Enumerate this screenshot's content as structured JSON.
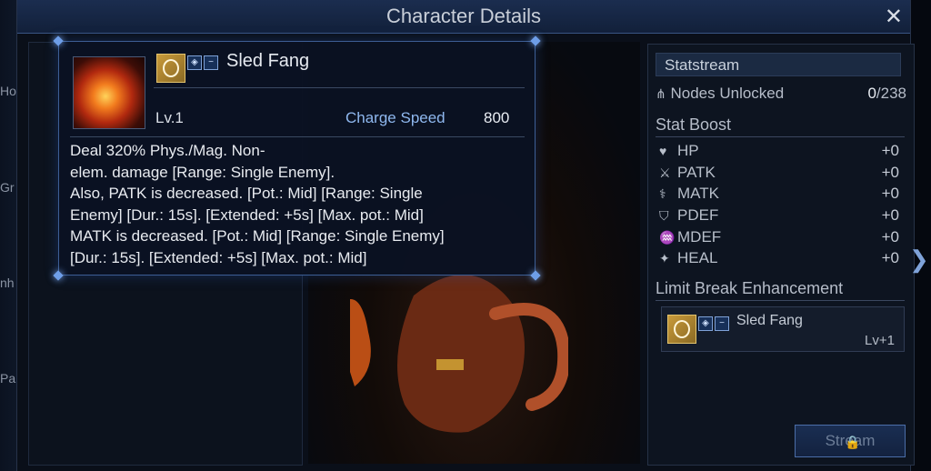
{
  "window": {
    "title": "Character Details",
    "close_label": "✕"
  },
  "left_edge": {
    "partial_labels": [
      "Ho",
      "Gr",
      "nh",
      "Pa"
    ]
  },
  "tooltip": {
    "ability_name": "Sled Fang",
    "level": "Lv.1",
    "charge_speed_label": "Charge Speed",
    "charge_speed_value": "800",
    "badge_minus": "−",
    "description": "Deal 320% Phys./Mag. Non-\nelem. damage [Range: Single Enemy].\nAlso, PATK is decreased. [Pot.: Mid] [Range: Single\nEnemy] [Dur.: 15s].  [Extended: +5s] [Max. pot.: Mid]\nMATK is decreased. [Pot.: Mid] [Range: Single Enemy]\n[Dur.: 15s].  [Extended: +5s] [Max. pot.: Mid]"
  },
  "statstream": {
    "header": "Statstream",
    "nodes_label": "Nodes Unlocked",
    "nodes_unlocked": "0",
    "nodes_total": "/238",
    "stat_boost_header": "Stat Boost",
    "stats": [
      {
        "icon": "heart-icon",
        "label": "HP",
        "value": "+0"
      },
      {
        "icon": "sword-icon",
        "label": "PATK",
        "value": "+0"
      },
      {
        "icon": "staff-icon",
        "label": "MATK",
        "value": "+0"
      },
      {
        "icon": "shield-icon",
        "label": "PDEF",
        "value": "+0"
      },
      {
        "icon": "hat-icon",
        "label": "MDEF",
        "value": "+0"
      },
      {
        "icon": "sparkle-icon",
        "label": "HEAL",
        "value": "+0"
      }
    ],
    "limit_break_header": "Limit Break Enhancement",
    "limit_break": {
      "name": "Sled Fang",
      "level": "Lv+1",
      "badge_minus": "−"
    },
    "stream_button": "Stream"
  },
  "colors": {
    "accent_blue": "#3d5e95",
    "charge_speed_blue": "#8fb8ef",
    "gold_icon": "#c89a3a"
  }
}
